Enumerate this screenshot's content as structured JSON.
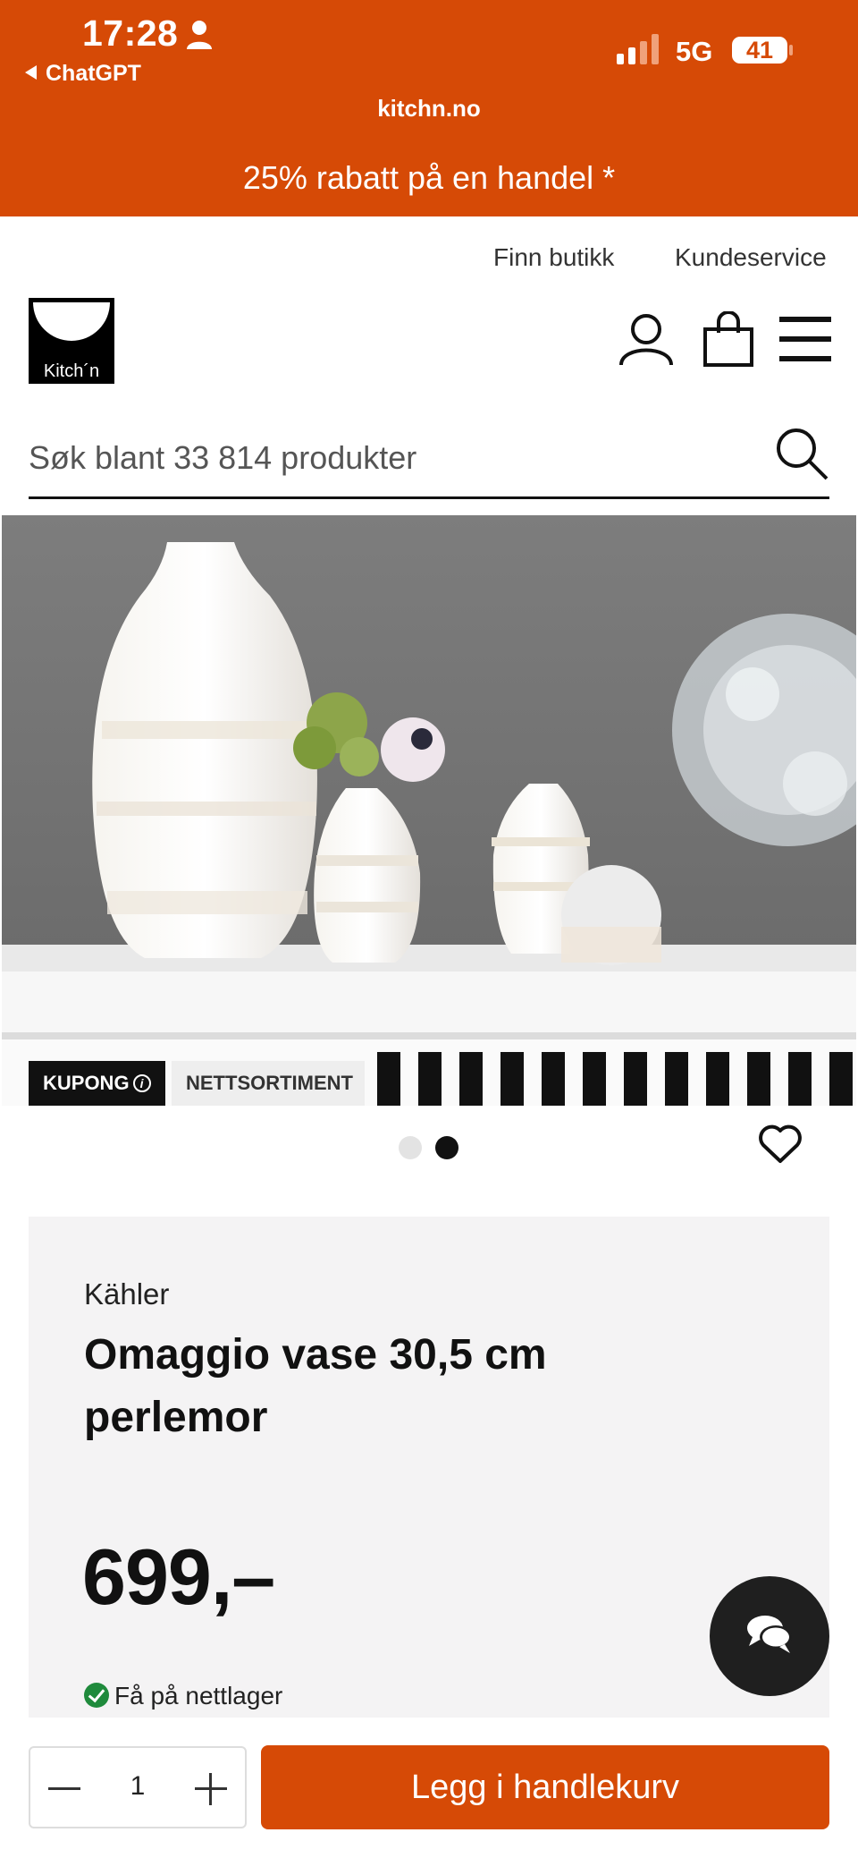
{
  "status_bar": {
    "time": "17:28",
    "back_app": "ChatGPT",
    "network": "5G",
    "battery": "41"
  },
  "browser": {
    "url": "kitchn.no"
  },
  "promo_banner": "25% rabatt på en handel *",
  "header": {
    "find_store": "Finn butikk",
    "customer_service": "Kundeservice",
    "logo_text": "Kitch´n"
  },
  "search": {
    "placeholder": "Søk blant 33 814 produkter"
  },
  "gallery": {
    "badges": {
      "coupon": "KUPONG",
      "online_only": "NETTSORTIMENT"
    },
    "active_slide": 2,
    "slide_count": 2
  },
  "product": {
    "brand": "Kähler",
    "name": "Omaggio vase 30,5 cm perlemor",
    "price": "699,–",
    "stock": "Få på nettlager"
  },
  "cart": {
    "quantity": "1",
    "add_label": "Legg i handlekurv"
  },
  "colors": {
    "brand": "#d64a06",
    "stock_ok": "#1f8a3c"
  }
}
